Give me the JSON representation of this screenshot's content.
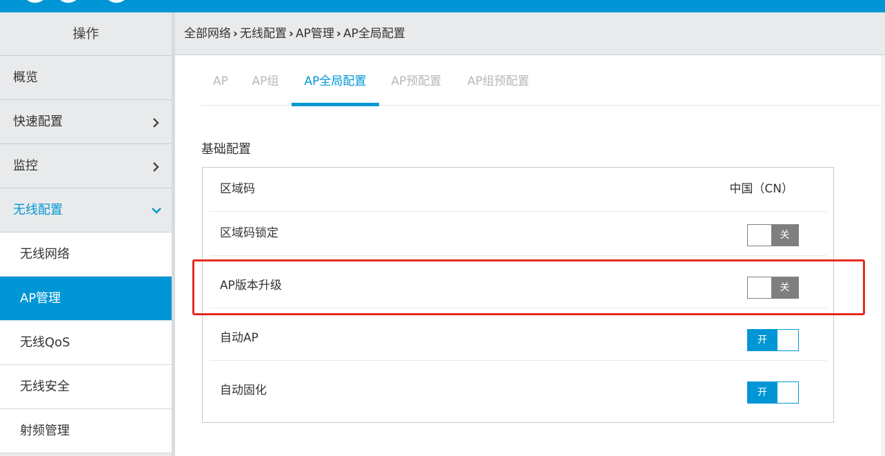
{
  "colors": {
    "brand": "#0096d6",
    "toggle_off": "#7f7f7f",
    "annotation_box": "#e8281e"
  },
  "sidebar": {
    "header": "操作",
    "items": [
      {
        "label": "概览",
        "chevron": ""
      },
      {
        "label": "快速配置",
        "chevron": "chevron-right-icon"
      },
      {
        "label": "监控",
        "chevron": "chevron-right-icon"
      },
      {
        "label": "无线配置",
        "chevron": "chevron-down-icon",
        "expanded": true
      }
    ],
    "subitems": [
      {
        "label": "无线网络"
      },
      {
        "label": "AP管理",
        "selected": true
      },
      {
        "label": "无线QoS"
      },
      {
        "label": "无线安全"
      },
      {
        "label": "射频管理"
      }
    ]
  },
  "breadcrumb": [
    "全部网络",
    "无线配置",
    "AP管理",
    "AP全局配置"
  ],
  "tabs": [
    {
      "label": "AP"
    },
    {
      "label": "AP组"
    },
    {
      "label": "AP全局配置",
      "active": true
    },
    {
      "label": "AP预配置"
    },
    {
      "label": "AP组预配置"
    }
  ],
  "section_title": "基础配置",
  "rows": [
    {
      "label": "区域码",
      "value": "中国（CN）"
    },
    {
      "label": "区域码锁定",
      "toggle": "关",
      "state": "off"
    },
    {
      "label": "AP版本升级",
      "toggle": "关",
      "state": "off",
      "highlighted": true
    },
    {
      "label": "自动AP",
      "toggle": "开",
      "state": "on"
    },
    {
      "label": "自动固化",
      "toggle": "开",
      "state": "on"
    }
  ]
}
